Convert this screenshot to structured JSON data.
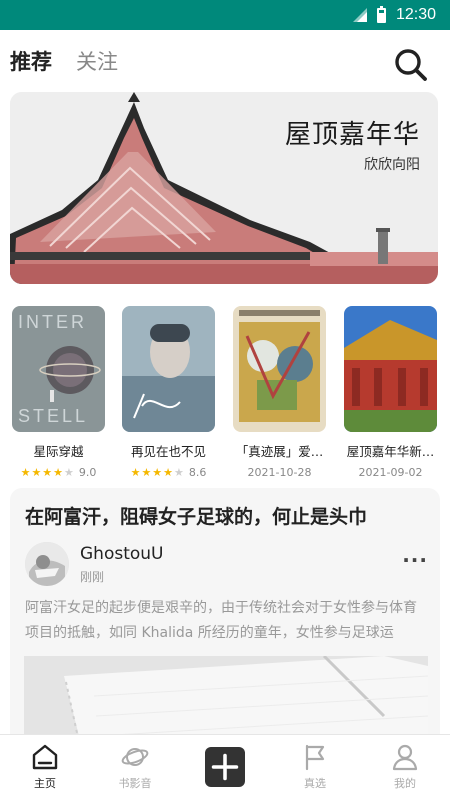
{
  "status_bar": {
    "time": "12:30"
  },
  "top_tabs": {
    "recommend": "推荐",
    "follow": "关注"
  },
  "banner": {
    "title": "屋顶嘉年华",
    "subtitle": "欣欣向阳"
  },
  "cards": [
    {
      "title": "星际穿越",
      "rating": "9.0",
      "stars": 4
    },
    {
      "title": "再见在也不见",
      "rating": "8.6",
      "stars": 4
    },
    {
      "title": "「真迹展」爱…",
      "date": "2021-10-28"
    },
    {
      "title": "屋顶嘉年华新…",
      "date": "2021-09-02"
    }
  ],
  "article": {
    "title": "在阿富汗，阻碍女子足球的，何止是头巾",
    "author": "GhostouU",
    "time": "刚刚",
    "more": "···",
    "excerpt": "阿富汗女足的起步便是艰辛的，由于传统社会对于女性参与体育项目的抵触，如同 Khalida 所经历的童年，女性参与足球运"
  },
  "bottom_nav": {
    "home": "主页",
    "media": "书影音",
    "picks": "真选",
    "mine": "我的"
  },
  "colors": {
    "status_bar": "#00897b",
    "star": "#f5b800",
    "nav_active": "#222222"
  }
}
